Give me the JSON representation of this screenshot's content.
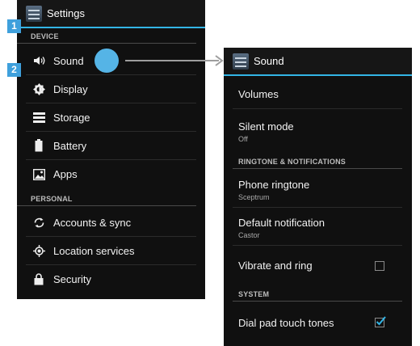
{
  "left": {
    "title": "Settings",
    "section_device": "DEVICE",
    "items": [
      {
        "label": "Sound",
        "icon": "speaker-icon"
      },
      {
        "label": "Display",
        "icon": "brightness-icon"
      },
      {
        "label": "Storage",
        "icon": "storage-icon"
      },
      {
        "label": "Battery",
        "icon": "battery-icon"
      },
      {
        "label": "Apps",
        "icon": "apps-icon"
      }
    ],
    "section_personal": "PERSONAL",
    "personal_items": [
      {
        "label": "Accounts & sync",
        "icon": "sync-icon"
      },
      {
        "label": "Location services",
        "icon": "location-icon"
      },
      {
        "label": "Security",
        "icon": "lock-icon"
      }
    ]
  },
  "right": {
    "title": "Sound",
    "volumes": "Volumes",
    "silent_mode": {
      "label": "Silent mode",
      "value": "Off"
    },
    "section_ringtone": "RINGTONE & NOTIFICATIONS",
    "phone_ringtone": {
      "label": "Phone ringtone",
      "value": "Sceptrum"
    },
    "default_notification": {
      "label": "Default notification",
      "value": "Castor"
    },
    "vibrate": {
      "label": "Vibrate and ring",
      "checked": false
    },
    "section_system": "SYSTEM",
    "dial_pad": {
      "label": "Dial pad touch tones",
      "checked": true
    }
  },
  "annotations": {
    "badge1": "1",
    "badge2": "2"
  },
  "colors": {
    "accent": "#33b5e5",
    "badge": "#3fa0dc",
    "touch": "#55b4e6"
  }
}
